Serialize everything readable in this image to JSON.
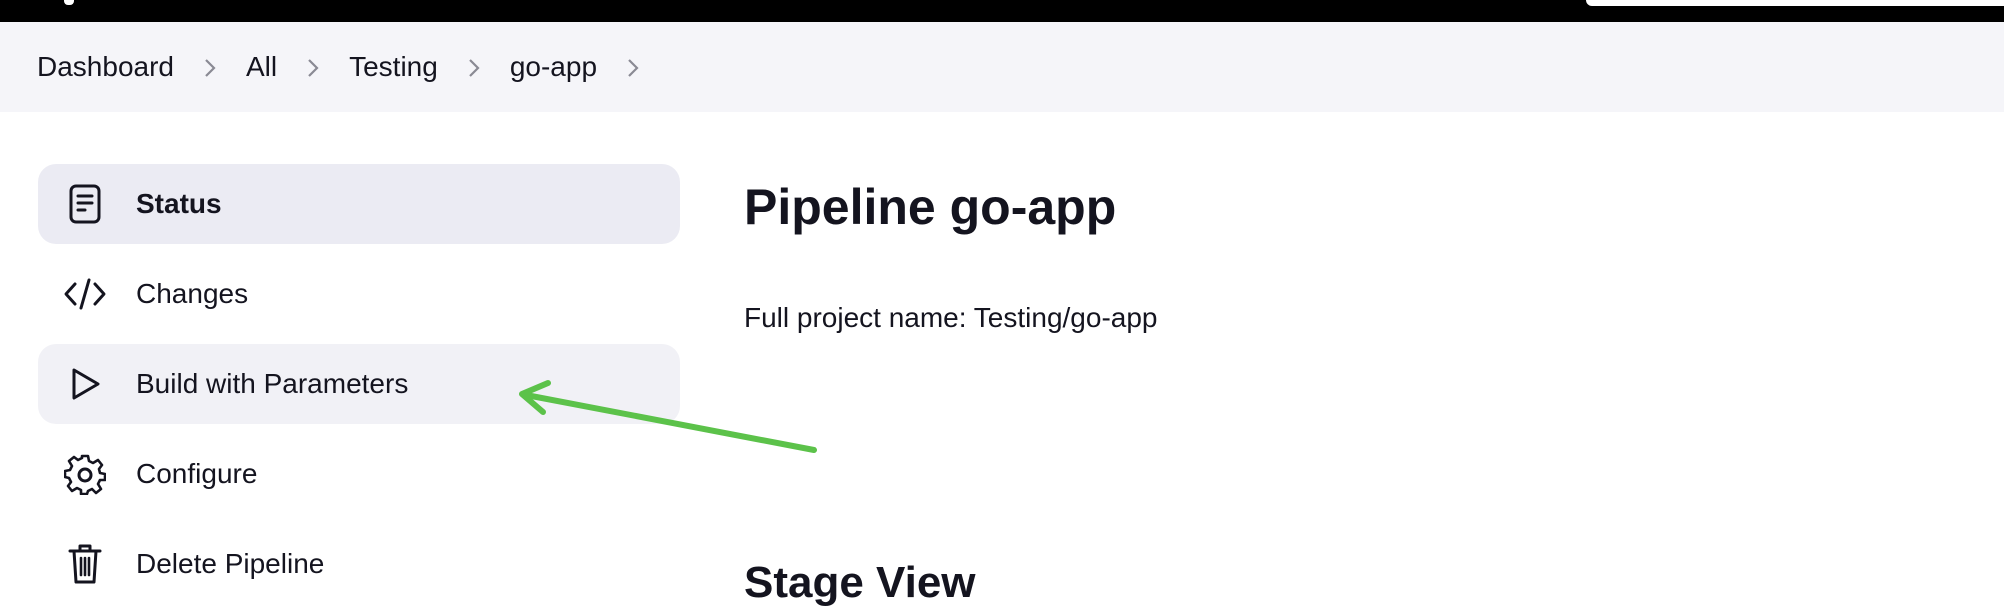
{
  "breadcrumbs": [
    "Dashboard",
    "All",
    "Testing",
    "go-app"
  ],
  "sidebar": {
    "items": [
      {
        "label": "Status",
        "icon": "document-icon"
      },
      {
        "label": "Changes",
        "icon": "code-icon"
      },
      {
        "label": "Build with Parameters",
        "icon": "play-icon"
      },
      {
        "label": "Configure",
        "icon": "gear-icon"
      },
      {
        "label": "Delete Pipeline",
        "icon": "trash-icon"
      }
    ]
  },
  "main": {
    "title": "Pipeline go-app",
    "full_project_name": "Full project name: Testing/go-app",
    "stage_view_title": "Stage View"
  },
  "colors": {
    "header_bg": "#000000",
    "breadcrumb_bg": "#f5f5f9",
    "active_item_bg": "#ebebf3",
    "annotation_arrow": "#5cc24a"
  }
}
